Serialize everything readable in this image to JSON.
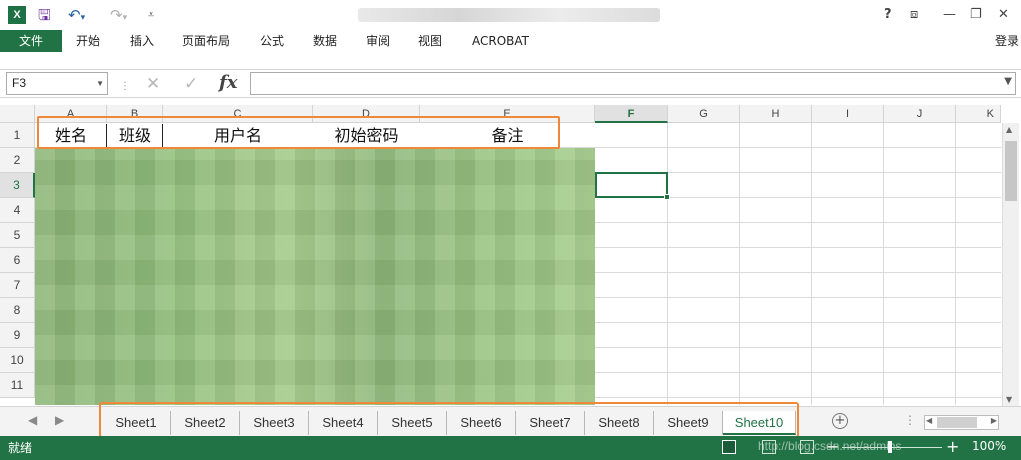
{
  "app": {
    "logo_letter": "X",
    "file_type_icon": "excel-icon"
  },
  "quick_access": {
    "save_icon": "save-icon",
    "undo_icon": "undo-icon",
    "redo_icon": "redo-icon",
    "customize_icon": "customize-icon"
  },
  "window": {
    "help": "?",
    "ribbon_display_icon": "ribbon-display-icon",
    "minimize": "—",
    "restore": "❐",
    "close": "✕"
  },
  "ribbon": {
    "file_tab": "文件",
    "tabs": [
      "开始",
      "插入",
      "页面布局",
      "公式",
      "数据",
      "审阅",
      "视图",
      "ACROBAT"
    ],
    "login": "登录"
  },
  "formula_bar": {
    "name_box": "F3",
    "cancel_icon": "✕",
    "enter_icon": "✓",
    "fx": "fx",
    "formula": ""
  },
  "grid": {
    "columns": [
      "A",
      "B",
      "C",
      "D",
      "E",
      "F",
      "G",
      "H",
      "I",
      "J",
      "K"
    ],
    "rows": [
      "1",
      "2",
      "3",
      "4",
      "5",
      "6",
      "7",
      "8",
      "9",
      "10",
      "11"
    ],
    "selected_column": "F",
    "selected_row": "3",
    "header_cells": [
      "姓名",
      "班级",
      "用户名",
      "初始密码",
      "备注"
    ]
  },
  "sheets": {
    "tabs": [
      "Sheet1",
      "Sheet2",
      "Sheet3",
      "Sheet4",
      "Sheet5",
      "Sheet6",
      "Sheet7",
      "Sheet8",
      "Sheet9",
      "Sheet10"
    ],
    "active": "Sheet10",
    "add_label": "+",
    "nav_prev": "◀",
    "nav_next": "▶"
  },
  "statusbar": {
    "status": "就绪",
    "watermark": "http://blog.csdn.net/admins",
    "zoom_minus": "−",
    "zoom_plus": "+",
    "zoom_level": "100%"
  },
  "colors": {
    "accent": "#217346",
    "highlight": "#f0883a"
  }
}
